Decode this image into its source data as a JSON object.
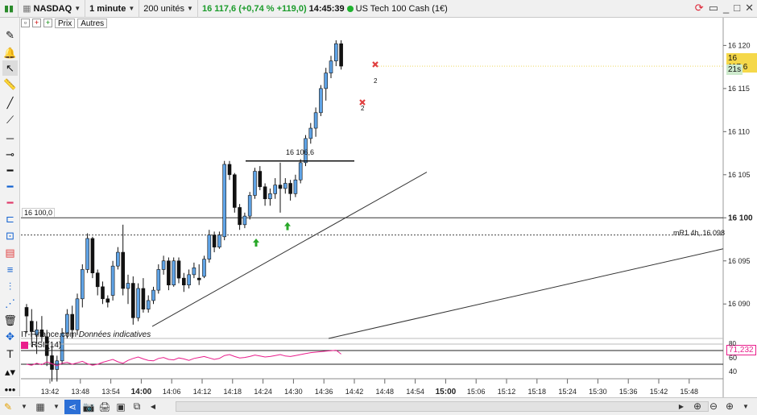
{
  "topbar": {
    "symbol": "NASDAQ",
    "interval": "1 minute",
    "units": "200 unités",
    "change": "16 117,6 (+0,74 % +119,0)",
    "time": "14:45:39",
    "instrument": "US Tech 100 Cash (1€)"
  },
  "subbar": {
    "prix": "Prix",
    "autres": "Autres"
  },
  "source_text": "IT-Finance.com",
  "source_note": "Données indicatives",
  "rsi": {
    "label": "RSI (14)",
    "value": "71,232",
    "levels": [
      "80",
      "60",
      "40"
    ]
  },
  "annotations": {
    "line_label": "16 100,0",
    "high_line_label": "16 106,6",
    "pivot_label": "mR1 4h, 16 098",
    "cross_count_a": "2",
    "cross_count_b": "2",
    "price_badge": "16 117,6",
    "countdown": "21s"
  },
  "chart_data": {
    "type": "candlestick",
    "y_ticks": [
      "16 120",
      "16 115",
      "16 110",
      "16 105",
      "16 100",
      "16 095",
      "16 090"
    ],
    "y_tick_values": [
      16120,
      16115,
      16110,
      16105,
      16100,
      16095,
      16090
    ],
    "x_ticks": [
      "13:42",
      "13:48",
      "13:54",
      "14:00",
      "14:06",
      "14:12",
      "14:18",
      "14:24",
      "14:30",
      "14:36",
      "14:42",
      "14:48",
      "14:54",
      "15:00",
      "15:06",
      "15:12",
      "15:18",
      "15:24",
      "15:30",
      "15:36",
      "15:42",
      "15:48"
    ],
    "x_tick_bold": [
      "14:00",
      "15:00"
    ],
    "current_price": 16117.6,
    "horizontal_line": 16100.0,
    "pivot_line": 16098,
    "candles": [
      {
        "o": 16089.6,
        "h": 16090,
        "l": 16086.6,
        "c": 16088.6
      },
      {
        "o": 16088,
        "h": 16089.4,
        "l": 16085,
        "c": 16086.8
      },
      {
        "o": 16086.4,
        "h": 16088,
        "l": 16084.2,
        "c": 16087
      },
      {
        "o": 16087,
        "h": 16088.6,
        "l": 16085.6,
        "c": 16086.2
      },
      {
        "o": 16086.2,
        "h": 16087,
        "l": 16082.8,
        "c": 16084
      },
      {
        "o": 16084,
        "h": 16085.2,
        "l": 16081,
        "c": 16082.4
      },
      {
        "o": 16082.4,
        "h": 16084,
        "l": 16081,
        "c": 16083.4
      },
      {
        "o": 16083.4,
        "h": 16087.2,
        "l": 16083,
        "c": 16086.6
      },
      {
        "o": 16086.6,
        "h": 16089.4,
        "l": 16086,
        "c": 16088.8
      },
      {
        "o": 16088.8,
        "h": 16089.8,
        "l": 16086,
        "c": 16087
      },
      {
        "o": 16087,
        "h": 16091.2,
        "l": 16086.4,
        "c": 16090.6
      },
      {
        "o": 16090.6,
        "h": 16094.6,
        "l": 16089.6,
        "c": 16094
      },
      {
        "o": 16094,
        "h": 16098.2,
        "l": 16093.6,
        "c": 16097.6
      },
      {
        "o": 16097.6,
        "h": 16097.8,
        "l": 16093,
        "c": 16093.6
      },
      {
        "o": 16093.6,
        "h": 16094,
        "l": 16091,
        "c": 16092
      },
      {
        "o": 16092,
        "h": 16092.6,
        "l": 16090,
        "c": 16090.6
      },
      {
        "o": 16090.6,
        "h": 16091,
        "l": 16089.6,
        "c": 16090.2
      },
      {
        "o": 16091,
        "h": 16095,
        "l": 16090.4,
        "c": 16094.4
      },
      {
        "o": 16094.4,
        "h": 16096.6,
        "l": 16094,
        "c": 16096
      },
      {
        "o": 16096,
        "h": 16099.2,
        "l": 16091,
        "c": 16091.8
      },
      {
        "o": 16091.8,
        "h": 16093.4,
        "l": 16090,
        "c": 16092.4
      },
      {
        "o": 16092.4,
        "h": 16093.2,
        "l": 16087.6,
        "c": 16088.4
      },
      {
        "o": 16088.4,
        "h": 16092.4,
        "l": 16088,
        "c": 16091.8
      },
      {
        "o": 16091.8,
        "h": 16093,
        "l": 16089,
        "c": 16089.4
      },
      {
        "o": 16089.4,
        "h": 16091,
        "l": 16089,
        "c": 16090.4
      },
      {
        "o": 16090.4,
        "h": 16092,
        "l": 16090,
        "c": 16091.6
      },
      {
        "o": 16091.6,
        "h": 16094.6,
        "l": 16091.2,
        "c": 16094
      },
      {
        "o": 16094,
        "h": 16095.6,
        "l": 16093.4,
        "c": 16095
      },
      {
        "o": 16095,
        "h": 16095.4,
        "l": 16091.6,
        "c": 16092.2
      },
      {
        "o": 16092.2,
        "h": 16095.4,
        "l": 16092,
        "c": 16095
      },
      {
        "o": 16095,
        "h": 16095.4,
        "l": 16092.4,
        "c": 16093
      },
      {
        "o": 16093,
        "h": 16093.6,
        "l": 16091.4,
        "c": 16092.2
      },
      {
        "o": 16092.2,
        "h": 16094,
        "l": 16091.8,
        "c": 16093.4
      },
      {
        "o": 16093.4,
        "h": 16094.8,
        "l": 16093,
        "c": 16094.2
      },
      {
        "o": 16093,
        "h": 16094.6,
        "l": 16092.2,
        "c": 16092.8
      },
      {
        "o": 16093.2,
        "h": 16095.6,
        "l": 16093,
        "c": 16095.2
      },
      {
        "o": 16095.2,
        "h": 16098.6,
        "l": 16094.8,
        "c": 16098
      },
      {
        "o": 16098,
        "h": 16098.4,
        "l": 16096,
        "c": 16096.6
      },
      {
        "o": 16096.6,
        "h": 16098.4,
        "l": 16096.4,
        "c": 16098
      },
      {
        "o": 16097.8,
        "h": 16106.6,
        "l": 16097.4,
        "c": 16106.2
      },
      {
        "o": 16106.2,
        "h": 16106.6,
        "l": 16104.4,
        "c": 16105
      },
      {
        "o": 16105,
        "h": 16105.2,
        "l": 16100.6,
        "c": 16101.2
      },
      {
        "o": 16101.2,
        "h": 16101.6,
        "l": 16098.6,
        "c": 16099.2
      },
      {
        "o": 16099.2,
        "h": 16100.6,
        "l": 16098.8,
        "c": 16100.2
      },
      {
        "o": 16100.2,
        "h": 16103,
        "l": 16099.8,
        "c": 16102.6
      },
      {
        "o": 16102.6,
        "h": 16105.8,
        "l": 16102.2,
        "c": 16105.4
      },
      {
        "o": 16105.4,
        "h": 16106,
        "l": 16103.2,
        "c": 16103.6
      },
      {
        "o": 16103.6,
        "h": 16104,
        "l": 16101.4,
        "c": 16102.2
      },
      {
        "o": 16102.2,
        "h": 16103.4,
        "l": 16101.4,
        "c": 16102.8
      },
      {
        "o": 16102.8,
        "h": 16104.6,
        "l": 16102.2,
        "c": 16103.8
      },
      {
        "o": 16103.8,
        "h": 16106.4,
        "l": 16100.6,
        "c": 16103.4
      },
      {
        "o": 16103.4,
        "h": 16104.6,
        "l": 16102.8,
        "c": 16104
      },
      {
        "o": 16104,
        "h": 16104.4,
        "l": 16102,
        "c": 16102.8
      },
      {
        "o": 16102.8,
        "h": 16105,
        "l": 16102.4,
        "c": 16104.4
      },
      {
        "o": 16104.4,
        "h": 16106.8,
        "l": 16104,
        "c": 16106.4
      },
      {
        "o": 16106.4,
        "h": 16109.6,
        "l": 16106,
        "c": 16109.2
      },
      {
        "o": 16109.2,
        "h": 16111,
        "l": 16108.6,
        "c": 16110.4
      },
      {
        "o": 16110.4,
        "h": 16112.8,
        "l": 16109.4,
        "c": 16112.2
      },
      {
        "o": 16112.2,
        "h": 16115.4,
        "l": 16111.8,
        "c": 16115
      },
      {
        "o": 16115,
        "h": 16117.4,
        "l": 16113.6,
        "c": 16116.8
      },
      {
        "o": 16116.8,
        "h": 16118.8,
        "l": 16116.2,
        "c": 16118.2
      },
      {
        "o": 16118.2,
        "h": 16120.6,
        "l": 16117.6,
        "c": 16120.2
      },
      {
        "o": 16120.2,
        "h": 16120.6,
        "l": 16117.2,
        "c": 16117.6
      }
    ],
    "rsi_values": [
      50,
      48,
      52,
      49,
      55,
      51,
      47,
      52,
      54,
      50,
      53,
      56,
      51,
      48,
      50,
      54,
      57,
      60,
      55,
      52,
      58,
      62,
      65,
      61,
      58,
      57,
      62,
      64,
      60,
      59,
      63,
      61,
      58,
      62,
      64,
      66,
      63,
      60,
      62,
      68,
      70,
      66,
      63,
      64,
      66,
      69,
      67,
      65,
      66,
      68,
      70,
      67,
      66,
      68,
      70,
      72,
      74,
      75,
      76,
      77,
      78,
      79,
      71
    ]
  }
}
